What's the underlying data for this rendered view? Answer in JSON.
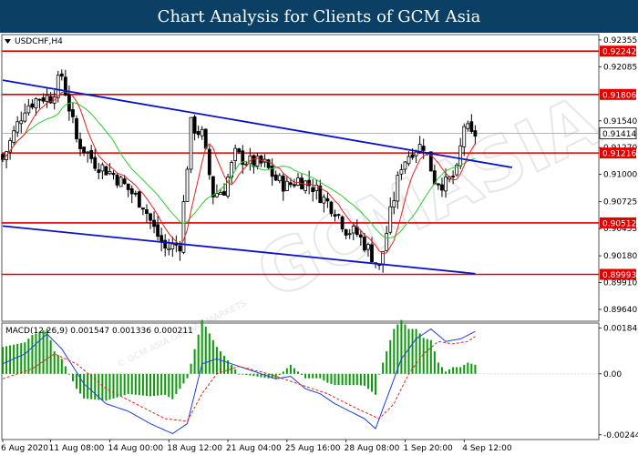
{
  "header": {
    "title": "Chart Analysis for Clients of GCM Asia"
  },
  "watermark": {
    "text": "GCMASIA",
    "sub": "© GCM ASIA GLOBAL MARKETS"
  },
  "colors": {
    "header_bg": "#0c3f64",
    "candle": "#000000",
    "ma_fast": "#e8221c",
    "ma_slow": "#2ecc2e",
    "channel": "#0a12c8",
    "level": "#e00000",
    "macd_hist": "#0a9a0a",
    "macd_line": "#1f3fd9",
    "signal_line": "#e8221c"
  },
  "chart_data": [
    {
      "type": "candlestick",
      "symbol_label": "USDCHF,H4",
      "ylim": [
        0.8953,
        0.924
      ],
      "y_ticks": [
        "0.92355",
        "0.92085",
        "0.91540",
        "0.91270",
        "0.91000",
        "0.90725",
        "0.90455",
        "0.90180",
        "0.89910",
        "0.89640"
      ],
      "y_tick_values": [
        0.92355,
        0.92085,
        0.9154,
        0.9127,
        0.91,
        0.90725,
        0.90455,
        0.9018,
        0.8991,
        0.8964
      ],
      "x_ticks": [
        "6 Aug 2020",
        "11 Aug 08:00",
        "14 Aug 00:00",
        "18 Aug 12:00",
        "21 Aug 04:00",
        "25 Aug 16:00",
        "28 Aug 08:00",
        "1 Sep 20:00",
        "4 Sep 12:00"
      ],
      "x_tick_index": [
        0,
        13,
        29,
        45,
        61,
        77,
        93,
        109,
        125
      ],
      "levels": [
        {
          "value": 0.92242,
          "label": "0.92242"
        },
        {
          "value": 0.91806,
          "label": "0.91806"
        },
        {
          "value": 0.91216,
          "label": "0.91216"
        },
        {
          "value": 0.90512,
          "label": "0.90512"
        },
        {
          "value": 0.89993,
          "label": "0.89993"
        }
      ],
      "current_price": {
        "value": 0.91414,
        "label": "0.91414"
      },
      "channel_lines": [
        {
          "from": [
            0,
            0.9195
          ],
          "to": [
            138,
            0.9107
          ]
        },
        {
          "from": [
            0,
            0.9048
          ],
          "to": [
            128,
            0.9
          ]
        }
      ],
      "moving_averages": [
        {
          "name": "fast",
          "period_hint": "red"
        },
        {
          "name": "slow",
          "period_hint": "green"
        }
      ],
      "anchors": [
        [
          0,
          0.9115
        ],
        [
          6,
          0.9168
        ],
        [
          10,
          0.9178
        ],
        [
          13,
          0.9178
        ],
        [
          16,
          0.92
        ],
        [
          20,
          0.9135
        ],
        [
          25,
          0.9112
        ],
        [
          30,
          0.91
        ],
        [
          34,
          0.9085
        ],
        [
          38,
          0.907
        ],
        [
          41,
          0.9045
        ],
        [
          44,
          0.9025
        ],
        [
          48,
          0.903
        ],
        [
          51,
          0.915
        ],
        [
          54,
          0.914
        ],
        [
          57,
          0.908
        ],
        [
          60,
          0.9085
        ],
        [
          63,
          0.912
        ],
        [
          67,
          0.9112
        ],
        [
          71,
          0.911
        ],
        [
          74,
          0.9095
        ],
        [
          77,
          0.9088
        ],
        [
          80,
          0.9095
        ],
        [
          84,
          0.9088
        ],
        [
          87,
          0.9075
        ],
        [
          90,
          0.9065
        ],
        [
          93,
          0.9045
        ],
        [
          96,
          0.904
        ],
        [
          99,
          0.9025
        ],
        [
          102,
          0.9005
        ],
        [
          105,
          0.906
        ],
        [
          108,
          0.911
        ],
        [
          111,
          0.9125
        ],
        [
          114,
          0.913
        ],
        [
          117,
          0.9095
        ],
        [
          120,
          0.909
        ],
        [
          123,
          0.9102
        ],
        [
          125,
          0.915
        ],
        [
          127,
          0.9138
        ],
        [
          128,
          0.9141
        ]
      ]
    },
    {
      "type": "line",
      "indicator_label": "MACD(12,26,9) 0.001547 0.001336 0.000211",
      "ylim": [
        -0.0026,
        0.002
      ],
      "y_ticks": [
        "0.001843",
        "0.00",
        "-0.002446"
      ],
      "y_tick_values": [
        0.001843,
        0.0,
        -0.002446
      ],
      "series": [
        {
          "name": "MACD",
          "anchors": [
            [
              0,
              0.0004
            ],
            [
              6,
              0.0008
            ],
            [
              12,
              0.0016
            ],
            [
              16,
              0.001
            ],
            [
              22,
              -0.0004
            ],
            [
              28,
              -0.0012
            ],
            [
              34,
              -0.0015
            ],
            [
              40,
              -0.002
            ],
            [
              46,
              -0.0024
            ],
            [
              50,
              -0.002
            ],
            [
              54,
              0.0004
            ],
            [
              58,
              0.0006
            ],
            [
              62,
              0.0004
            ],
            [
              68,
              0.0001
            ],
            [
              74,
              -0.0002
            ],
            [
              78,
              -0.0001
            ],
            [
              82,
              -0.0006
            ],
            [
              86,
              -0.0008
            ],
            [
              90,
              -0.0012
            ],
            [
              94,
              -0.0015
            ],
            [
              98,
              -0.0018
            ],
            [
              101,
              -0.0022
            ],
            [
              104,
              -0.001
            ],
            [
              108,
              0.0006
            ],
            [
              112,
              0.0014
            ],
            [
              116,
              0.0018
            ],
            [
              120,
              0.0013
            ],
            [
              124,
              0.0014
            ],
            [
              128,
              0.0017
            ]
          ]
        },
        {
          "name": "Signal",
          "anchors": [
            [
              0,
              -0.0002
            ],
            [
              8,
              0.0002
            ],
            [
              14,
              0.0008
            ],
            [
              20,
              0.0004
            ],
            [
              28,
              -0.0006
            ],
            [
              36,
              -0.0012
            ],
            [
              44,
              -0.0018
            ],
            [
              50,
              -0.0019
            ],
            [
              54,
              -0.0008
            ],
            [
              58,
              0.0
            ],
            [
              64,
              0.0003
            ],
            [
              72,
              0.0
            ],
            [
              80,
              -0.0004
            ],
            [
              88,
              -0.0008
            ],
            [
              96,
              -0.0014
            ],
            [
              102,
              -0.0018
            ],
            [
              106,
              -0.0012
            ],
            [
              110,
              0.0
            ],
            [
              114,
              0.0008
            ],
            [
              118,
              0.0013
            ],
            [
              122,
              0.0012
            ],
            [
              126,
              0.0013
            ],
            [
              128,
              0.0015
            ]
          ]
        }
      ]
    }
  ]
}
